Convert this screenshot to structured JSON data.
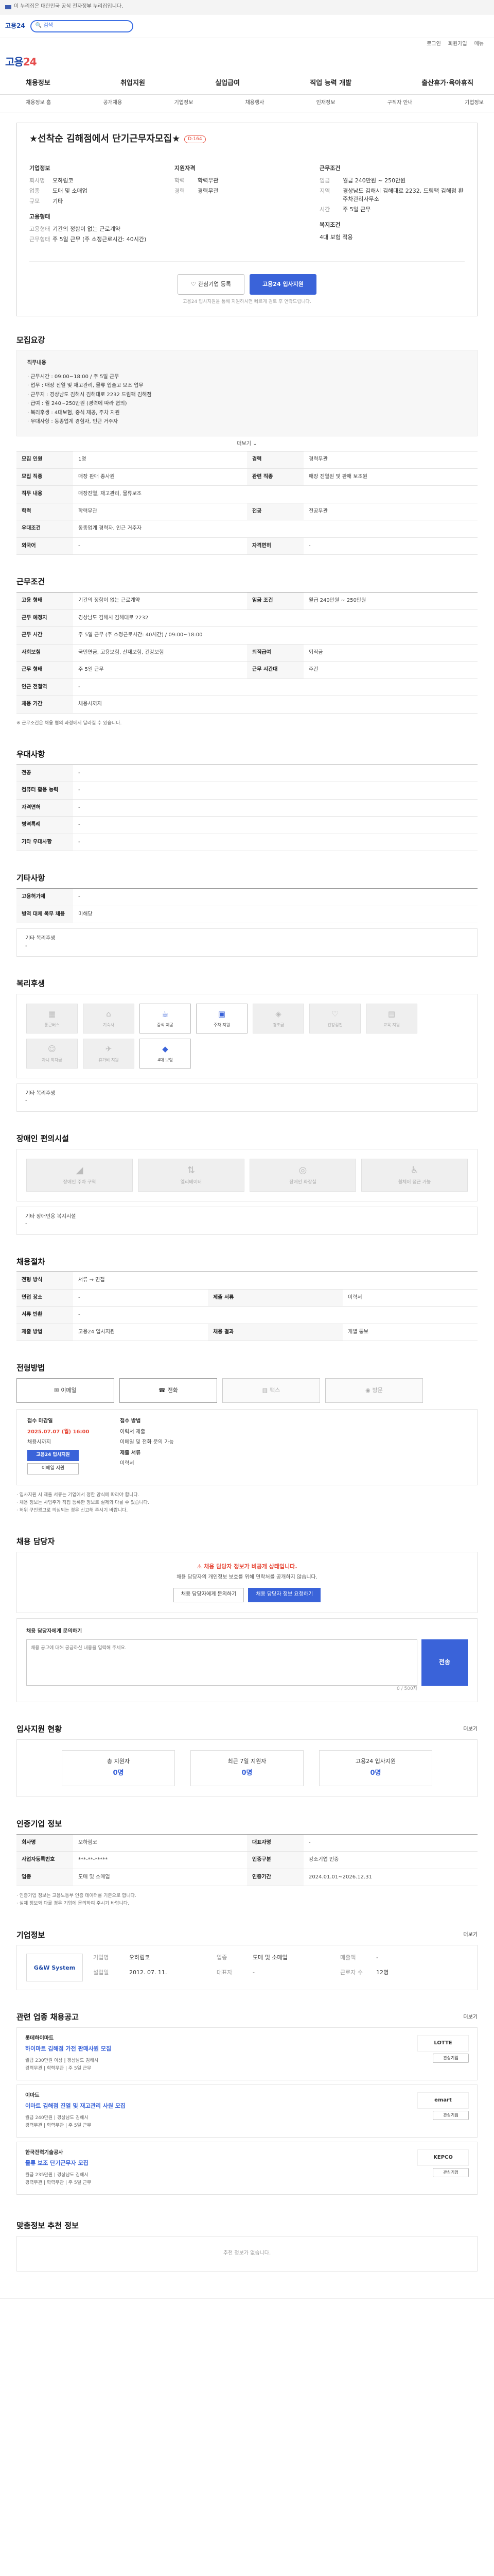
{
  "topbar": {
    "text": "이 누리집은 대한민국 공식 전자정부 누리집입니다."
  },
  "search": {
    "label": "검색"
  },
  "util": [
    "로그인",
    "회원가입",
    "메뉴"
  ],
  "logo": {
    "a": "고용",
    "b": "24"
  },
  "gnb": [
    "채용정보",
    "취업지원",
    "실업급여",
    "직업 능력 개발",
    "출산휴가·육아휴직"
  ],
  "snb": [
    "채용정보 홈",
    "공개채용",
    "기업정보",
    "채용행사",
    "인재정보",
    "구직자 안내",
    "기업정보"
  ],
  "title": {
    "heading": "★선착순 김해점에서 단기근무자모집★",
    "dday": "D-164"
  },
  "company": {
    "heading": "기업정보",
    "rows": [
      {
        "k": "회사명",
        "v": "오하림코"
      },
      {
        "k": "업종",
        "v": "도매 및 소매업"
      },
      {
        "k": "규모",
        "v": "기타"
      }
    ]
  },
  "summary": {
    "heading": "지원자격",
    "rows": [
      {
        "k": "학력",
        "v": "학력무관"
      },
      {
        "k": "경력",
        "v": "경력무관"
      }
    ]
  },
  "conditions": {
    "heading": "근무조건",
    "rows": [
      {
        "k": "임금",
        "v": "월급 240만원 ~ 250만원"
      },
      {
        "k": "지역",
        "v": "경상남도 김해시 김해대로 2232, 드림팩 김해점 환주차관리사무소"
      },
      {
        "k": "시간",
        "v": "주 5일 근무"
      }
    ]
  },
  "employ": {
    "heading": "고용형태",
    "rows": [
      {
        "k": "고용형태",
        "v": "기간의 정함이 없는 근로계약"
      },
      {
        "k": "근무형태",
        "v": "주 5일 근무 (주 소정근로시간: 40시간)"
      }
    ]
  },
  "welfare_top": {
    "heading": "복지조건",
    "v": "4대 보험 적용"
  },
  "buttons": {
    "scrap": "관심기업 등록",
    "apply": "고용24 입사지원"
  },
  "topnote": "고용24 입사지원을 통해 지원하시면 빠르게 검토 후 연락드립니다.",
  "job": {
    "heading": "모집요강",
    "box_title": "직무내용",
    "lines": [
      "· 근무시간 : 09:00~18:00 / 주 5일 근무",
      "· 업무 : 매장 진열 및 재고관리, 물류 입출고 보조 업무",
      "· 근무지 : 경상남도 김해시 김해대로 2232 드림팩 김해점",
      "· 급여 : 월 240~250만원 (경력에 따라 협의)",
      "· 복리후생 : 4대보험, 중식 제공, 주차 지원",
      "· 우대사항 : 동종업계 경험자, 인근 거주자"
    ],
    "more": "더보기"
  },
  "req": {
    "rows": [
      {
        "k1": "모집 인원",
        "v1": "1명",
        "k2": "경력",
        "v2": "경력무관"
      },
      {
        "k1": "모집 직종",
        "v1": "매장 판매 종사원",
        "k2": "관련 직종",
        "v2": "매장 진열원 및 판매 보조원"
      },
      {
        "k1": "직무 내용",
        "v1": "매장진열, 재고관리, 물류보조",
        "k2": "",
        "v2": ""
      },
      {
        "k1": "학력",
        "v1": "학력무관",
        "k2": "전공",
        "v2": "전공무관"
      },
      {
        "k1": "우대조건",
        "v1": "동종업계 경력자, 인근 거주자",
        "k2": "",
        "v2": ""
      },
      {
        "k1": "외국어",
        "v1": "-",
        "k2": "자격면허",
        "v2": "-"
      }
    ]
  },
  "work": {
    "heading": "근무조건",
    "rows": [
      {
        "k1": "고용 형태",
        "v1": "기간의 정함이 없는 근로계약",
        "k2": "임금 조건",
        "v2": "월급 240만원 ~ 250만원"
      },
      {
        "k1": "근무 예정지",
        "v1": "경상남도 김해시 김해대로 2232",
        "k2": "",
        "v2": ""
      },
      {
        "k1": "근무 시간",
        "v1": "주 5일 근무 (주 소정근로시간: 40시간) / 09:00~18:00",
        "k2": "",
        "v2": ""
      },
      {
        "k1": "사회보험",
        "v1": "국민연금, 고용보험, 산재보험, 건강보험",
        "k2": "퇴직급여",
        "v2": "퇴직금"
      },
      {
        "k1": "근무 형태",
        "v1": "주 5일 근무",
        "k2": "근무 시간대",
        "v2": "주간"
      },
      {
        "k1": "인근 전철역",
        "v1": "-",
        "k2": "",
        "v2": ""
      },
      {
        "k1": "채용 기간",
        "v1": "채용시까지",
        "k2": "",
        "v2": ""
      }
    ],
    "note": "※ 근무조건은 채용 협의 과정에서 달라질 수 있습니다."
  },
  "extra": {
    "heading": "우대사항",
    "rows": [
      {
        "k": "전공",
        "v": "-"
      },
      {
        "k": "컴퓨터 활용 능력",
        "v": "-"
      },
      {
        "k": "자격면허",
        "v": "-"
      },
      {
        "k": "병역특례",
        "v": "-"
      },
      {
        "k": "기타 우대사항",
        "v": "-"
      }
    ]
  },
  "etc": {
    "heading": "기타사항",
    "rows": [
      {
        "k": "고용허가제",
        "v": "-"
      },
      {
        "k": "병역 대체 복무 채용",
        "v": "미해당"
      }
    ],
    "sub": "기타 복리후생",
    "subv": "-"
  },
  "benefit": {
    "heading": "복리후생",
    "items": [
      {
        "icon": "building-icon",
        "label": "통근버스",
        "on": false
      },
      {
        "icon": "home-icon",
        "label": "기숙사",
        "on": false
      },
      {
        "icon": "cup-icon",
        "label": "중식 제공",
        "on": true
      },
      {
        "icon": "car-icon",
        "label": "주차 지원",
        "on": true
      },
      {
        "icon": "gift-icon",
        "label": "경조금",
        "on": false
      },
      {
        "icon": "heart-icon",
        "label": "건강검진",
        "on": false
      },
      {
        "icon": "book-icon",
        "label": "교육 지원",
        "on": false
      },
      {
        "icon": "child-icon",
        "label": "자녀 학자금",
        "on": false
      },
      {
        "icon": "plane-icon",
        "label": "휴가비 지원",
        "on": false
      },
      {
        "icon": "shield-icon",
        "label": "4대 보험",
        "on": true
      }
    ],
    "sub": "기타 복리후생",
    "subv": "-"
  },
  "disab": {
    "heading": "장애인 편의시설",
    "items": [
      {
        "icon": "ramp-icon",
        "label": "장애인 주차 구역"
      },
      {
        "icon": "elevator-icon",
        "label": "엘리베이터"
      },
      {
        "icon": "toilet-icon",
        "label": "장애인 화장실"
      },
      {
        "icon": "wheelchair-icon",
        "label": "휠체어 접근 가능"
      }
    ],
    "sub": "기타 장애인용 복지시설",
    "subv": "-"
  },
  "process": {
    "heading": "채용절차",
    "rows": [
      {
        "k1": "전형 방식",
        "v1": "서류 → 면접",
        "k2": "",
        "v2": ""
      },
      {
        "k1": "면접 장소",
        "v1": "-",
        "k2": "제출 서류",
        "v2": "이력서"
      },
      {
        "k1": "서류 반환",
        "v1": "-",
        "k2": "",
        "v2": ""
      },
      {
        "k1": "제출 방법",
        "v1": "고용24 입사지원",
        "k2": "채용 결과",
        "v2": "개별 통보"
      }
    ]
  },
  "apply": {
    "heading": "전형방법",
    "btns": [
      {
        "icon": "mail-icon",
        "label": "이메일",
        "on": true
      },
      {
        "icon": "phone-icon",
        "label": "전화",
        "on": true
      },
      {
        "icon": "fax-icon",
        "label": "팩스",
        "on": false
      },
      {
        "icon": "visit-icon",
        "label": "방문",
        "on": false
      }
    ],
    "c1lab": "접수 마감일",
    "c1val": "2025.07.07 (월) 16:00",
    "c1sub": "채용시까지",
    "c2lab": "접수 방법",
    "c2val": "이력서 제출",
    "c2sub": "이메일 및 전화 문의 가능",
    "c2lab2": "제출 서류",
    "c2val2": "이력서",
    "applybtn": "고용24 입사지원",
    "emailbtn": "이메일 지원",
    "notes": [
      "· 입사지원 시 제출 서류는 기업에서 정한 양식에 따라야 합니다.",
      "· 채용 정보는 사업주가 직접 등록한 정보로 실제와 다를 수 있습니다.",
      "· 허위 구인광고로 의심되는 경우 신고해 주시기 바랍니다."
    ]
  },
  "manager": {
    "heading": "채용 담당자",
    "warn": "채용 담당자 정보가 비공개 상태입니다.",
    "desc": "채용 담당자의 개인정보 보호를 위해 연락처를 공개하지 않습니다.",
    "b1": "채용 담당자에게 문의하기",
    "b2": "채용 담당자 정보 요청하기"
  },
  "qa": {
    "title": "채용 담당자에게 문의하기",
    "placeholder": "채용 공고에 대해 궁금하신 내용을 입력해 주세요.",
    "send": "전송",
    "count": "0 / 500자"
  },
  "applicants": {
    "heading": "입사지원 현황",
    "more": "더보기",
    "stats": [
      {
        "n": "총 지원자",
        "v": "0명"
      },
      {
        "n": "최근 7일 지원자",
        "v": "0명"
      },
      {
        "n": "고용24 입사지원",
        "v": "0명"
      }
    ]
  },
  "info": {
    "heading": "인증기업 정보",
    "rows": [
      {
        "k1": "회사명",
        "v1": "오하림코",
        "k2": "대표자명",
        "v2": "-"
      },
      {
        "k1": "사업자등록번호",
        "v1": "***-**-*****",
        "k2": "인증구분",
        "v2": "강소기업 인증"
      },
      {
        "k1": "업종",
        "v1": "도매 및 소매업",
        "k2": "인증기간",
        "v2": "2024.01.01~2026.12.31"
      }
    ],
    "notes": [
      "· 인증기업 정보는 고용노동부 인증 데이터를 기준으로 합니다.",
      "· 실제 정보와 다를 경우 기업에 문의하여 주시기 바랍니다."
    ]
  },
  "corp": {
    "heading": "기업정보",
    "more": "더보기",
    "logo": "G&W System",
    "rows": [
      {
        "k": "기업명",
        "v": "오하림코"
      },
      {
        "k": "업종",
        "v": "도매 및 소매업"
      },
      {
        "k": "매출액",
        "v": "-"
      },
      {
        "k": "설립일",
        "v": "2012. 07. 11."
      },
      {
        "k": "대표자",
        "v": "-"
      },
      {
        "k": "근로자 수",
        "v": "12명"
      }
    ]
  },
  "similar": {
    "heading": "관련 업종 채용공고",
    "more": "더보기",
    "items": [
      {
        "company": "롯데하이마트",
        "title": "하이마트 김해점 가전 판매사원 모집",
        "meta": [
          "월급 230만원 이상 | 경상남도 김해시",
          "경력무관 | 학력무관 | 주 5일 근무"
        ],
        "logo": "LOTTE",
        "tag": "관심기업"
      },
      {
        "company": "이마트",
        "title": "이마트 김해점 진열 및 재고관리 사원 모집",
        "meta": [
          "월급 240만원 | 경상남도 김해시",
          "경력무관 | 학력무관 | 주 5일 근무"
        ],
        "logo": "emart",
        "tag": "관심기업"
      },
      {
        "company": "한국전력기술공사",
        "title": "물류 보조 단기근무자 모집",
        "meta": [
          "월급 235만원 | 경상남도 김해시",
          "경력무관 | 학력무관 | 주 5일 근무"
        ],
        "logo": "KEPCO",
        "tag": "관심기업"
      }
    ]
  },
  "recommend": {
    "heading": "맞춤정보 추천 정보",
    "empty": "추천 정보가 없습니다."
  }
}
